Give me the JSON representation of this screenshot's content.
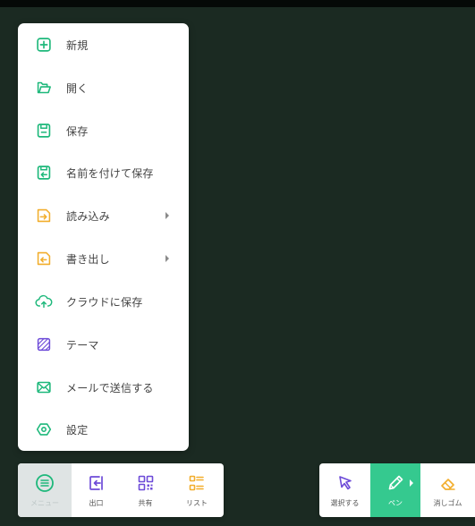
{
  "theme": {
    "canvas_bg": "#1b2a22",
    "menu_bg": "#ffffff",
    "accent_green": "#35c98f",
    "accent_orange": "#f2ae2d",
    "accent_purple": "#6d4bd8",
    "icon_green": "#1eb87b"
  },
  "file_menu": {
    "items": [
      {
        "label": "新規",
        "icon": "new-file-icon"
      },
      {
        "label": "開く",
        "icon": "folder-open-icon"
      },
      {
        "label": "保存",
        "icon": "save-icon"
      },
      {
        "label": "名前を付けて保存",
        "icon": "save-as-icon"
      },
      {
        "label": "読み込み",
        "icon": "import-icon",
        "has_submenu": true
      },
      {
        "label": "書き出し",
        "icon": "export-icon",
        "has_submenu": true
      },
      {
        "label": "クラウドに保存",
        "icon": "cloud-upload-icon"
      },
      {
        "label": "テーマ",
        "icon": "theme-pattern-icon"
      },
      {
        "label": "メールで送信する",
        "icon": "mail-icon"
      },
      {
        "label": "設定",
        "icon": "settings-hexagon-icon"
      }
    ]
  },
  "toolbar": {
    "left": {
      "menu": {
        "label": "メニュー",
        "icon": "menu-circle-icon"
      },
      "exit": {
        "label": "出口",
        "icon": "exit-icon"
      },
      "share": {
        "label": "共有",
        "icon": "qr-code-icon"
      },
      "list": {
        "label": "リスト",
        "icon": "list-icon"
      }
    },
    "right": {
      "select": {
        "label": "選択する",
        "icon": "cursor-arrow-icon"
      },
      "pen": {
        "label": "ペン",
        "icon": "pen-icon",
        "active": true
      },
      "eraser": {
        "label": "消しゴム",
        "icon": "eraser-icon"
      }
    }
  }
}
